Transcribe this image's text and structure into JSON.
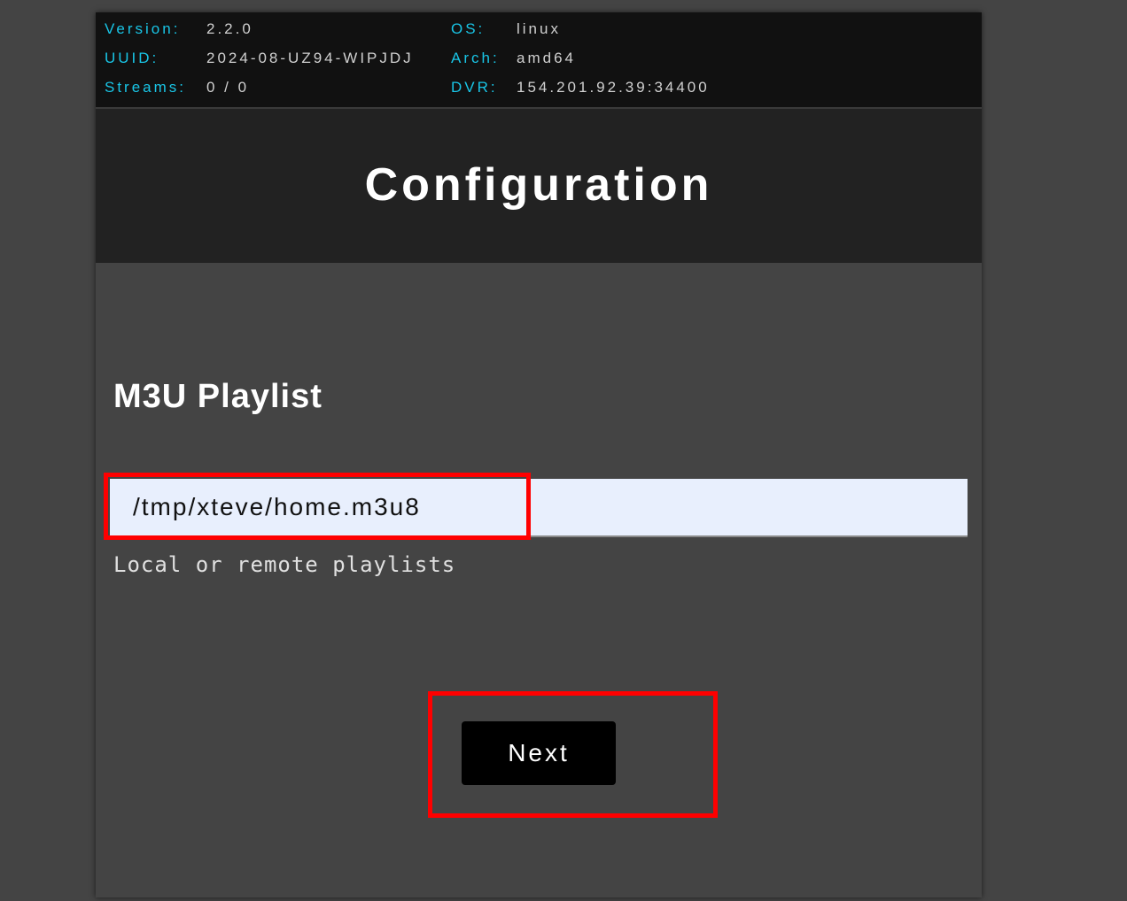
{
  "info": {
    "version_label": "Version:",
    "version_value": "2.2.0",
    "uuid_label": "UUID:",
    "uuid_value": "2024-08-UZ94-WIPJDJ",
    "streams_label": "Streams:",
    "streams_value": "0 / 0",
    "os_label": "OS:",
    "os_value": "linux",
    "arch_label": "Arch:",
    "arch_value": "amd64",
    "dvr_label": "DVR:",
    "dvr_value": "154.201.92.39:34400"
  },
  "header": {
    "title": "Configuration"
  },
  "playlist": {
    "title": "M3U Playlist",
    "input_value": "/tmp/xteve/home.m3u8",
    "hint": "Local or remote playlists"
  },
  "actions": {
    "next_label": "Next"
  },
  "colors": {
    "accent": "#19c5e6",
    "highlight": "#ff0000",
    "input_bg": "#e8effd"
  }
}
